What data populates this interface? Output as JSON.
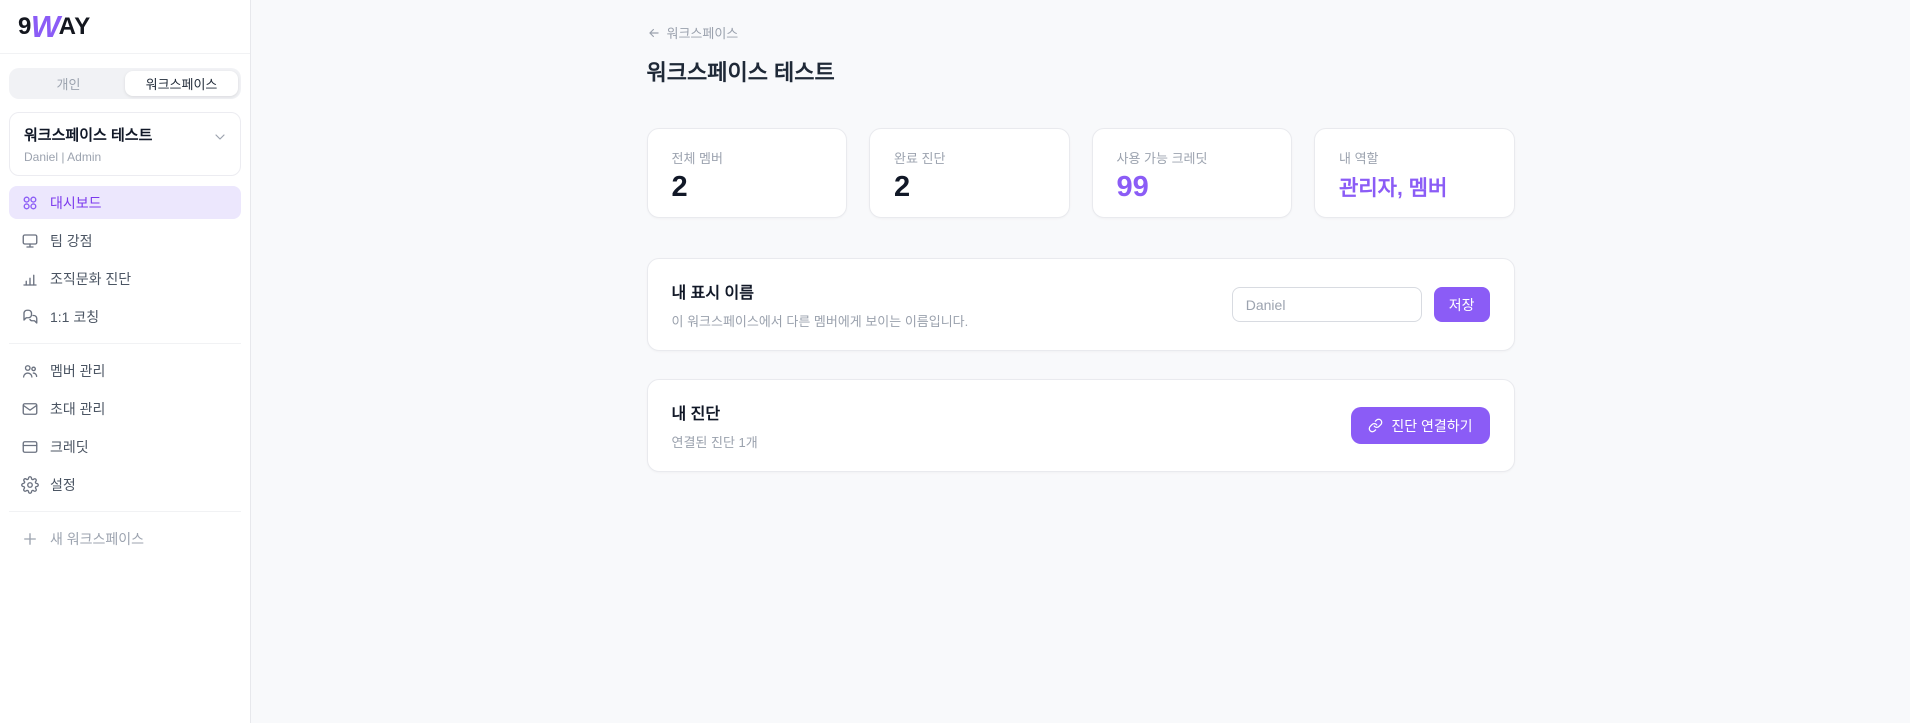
{
  "brand": {
    "logo_prefix": "9",
    "logo_mid": "W",
    "logo_suffix": "AY"
  },
  "colors": {
    "accent": "#8b5cf6",
    "accent_text": "#7c3aed",
    "accent_bg": "#ece7fd",
    "main_bg": "#f8f9fb"
  },
  "sidebar": {
    "tabs": [
      {
        "label": "개인",
        "active": false
      },
      {
        "label": "워크스페이스",
        "active": true
      }
    ],
    "workspace_selector": {
      "name": "워크스페이스 테스트",
      "subtitle": "Daniel | Admin",
      "icon": "chevron-down-icon"
    },
    "menu_primary": [
      {
        "label": "대시보드",
        "icon": "dashboard-icon",
        "active": true
      },
      {
        "label": "팀 강점",
        "icon": "monitor-icon",
        "active": false
      },
      {
        "label": "조직문화 진단",
        "icon": "bar-chart-icon",
        "active": false
      },
      {
        "label": "1:1 코칭",
        "icon": "chat-bubbles-icon",
        "active": false
      }
    ],
    "menu_secondary": [
      {
        "label": "멤버 관리",
        "icon": "users-icon"
      },
      {
        "label": "초대 관리",
        "icon": "mail-icon"
      },
      {
        "label": "크레딧",
        "icon": "credit-card-icon"
      },
      {
        "label": "설정",
        "icon": "gear-icon"
      }
    ],
    "new_workspace": {
      "label": "새 워크스페이스",
      "icon": "plus-icon"
    }
  },
  "main": {
    "back_link": {
      "label": "워크스페이스",
      "icon": "back-arrow-icon"
    },
    "page_title": "워크스페이스 테스트",
    "stats": [
      {
        "label": "전체 멤버",
        "value": "2"
      },
      {
        "label": "완료 진단",
        "value": "2"
      },
      {
        "label": "사용 가능 크레딧",
        "value": "99"
      },
      {
        "label": "내 역할",
        "value": "관리자, 멤버"
      }
    ],
    "display_name_card": {
      "title": "내 표시 이름",
      "description": "이 워크스페이스에서 다른 멤버에게 보이는 이름입니다.",
      "input_placeholder": "Daniel",
      "save_label": "저장"
    },
    "diagnosis_card": {
      "title": "내 진단",
      "subtitle": "연결된 진단 1개",
      "button_label": "진단 연결하기",
      "button_icon": "link-icon"
    }
  }
}
